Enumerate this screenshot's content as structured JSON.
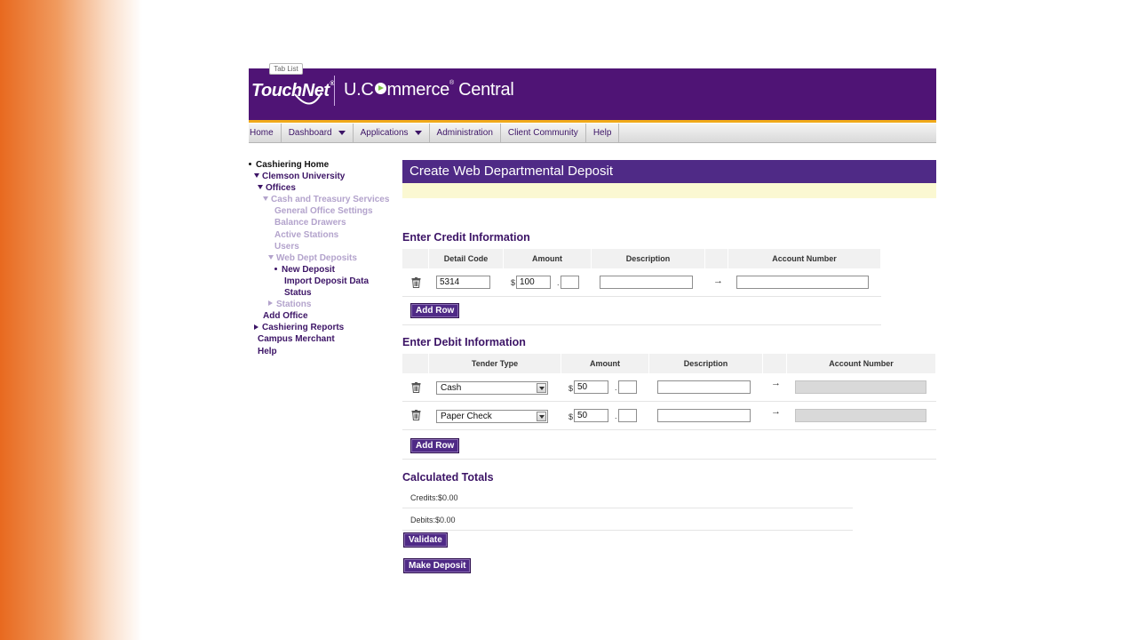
{
  "header": {
    "tab_tip": "Tab List",
    "logo_touchnet": "TouchNet",
    "logo_ucommerce_pre": "U.C",
    "logo_ucommerce_post": "mmerce",
    "logo_central": "Central",
    "colors": {
      "banner": "#4f1475",
      "accent": "#f0a91a"
    }
  },
  "nav": [
    {
      "label": "Home"
    },
    {
      "label": "Dashboard",
      "dropdown": true
    },
    {
      "label": "Applications",
      "dropdown": true
    },
    {
      "label": "Administration"
    },
    {
      "label": "Client Community"
    },
    {
      "label": "Help"
    }
  ],
  "tree": [
    {
      "label": "Cashiering Home",
      "indent": 0,
      "icon": "bullet",
      "style": "black"
    },
    {
      "label": "Clemson University",
      "indent": 1,
      "icon": "down",
      "style": "purple"
    },
    {
      "label": "Offices",
      "indent": 2,
      "icon": "down",
      "style": "purple"
    },
    {
      "label": "Cash and Treasury Services",
      "indent": 3,
      "icon": "down",
      "style": "muted"
    },
    {
      "label": "General Office Settings",
      "indent": 5,
      "icon": "",
      "style": "muted"
    },
    {
      "label": "Balance Drawers",
      "indent": 5,
      "icon": "",
      "style": "muted"
    },
    {
      "label": "Active Stations",
      "indent": 5,
      "icon": "",
      "style": "muted"
    },
    {
      "label": "Users",
      "indent": 5,
      "icon": "",
      "style": "muted"
    },
    {
      "label": "Web Dept Deposits",
      "indent": 4,
      "icon": "down",
      "style": "muted"
    },
    {
      "label": "New Deposit",
      "indent": 5,
      "icon": "bullet",
      "style": "purple"
    },
    {
      "label": "Import Deposit Data",
      "indent": 6,
      "icon": "",
      "style": "purple"
    },
    {
      "label": "Status",
      "indent": 6,
      "icon": "",
      "style": "purple"
    },
    {
      "label": "Stations",
      "indent": 4,
      "icon": "right",
      "style": "muted"
    },
    {
      "label": "Add Office",
      "indent": 3,
      "icon": "",
      "style": "purple"
    },
    {
      "label": "Cashiering Reports",
      "indent": 1,
      "icon": "right",
      "style": "purple"
    },
    {
      "label": "Campus Merchant",
      "indent": 2,
      "icon": "",
      "style": "purple"
    },
    {
      "label": "Help",
      "indent": 2,
      "icon": "",
      "style": "purple"
    }
  ],
  "main": {
    "title": "Create Web Departmental Deposit",
    "credit": {
      "heading": "Enter Credit Information",
      "columns": [
        "Detail Code",
        "Amount",
        "Description",
        "Account Number"
      ],
      "rows": [
        {
          "detail_code": "5314",
          "amount_dollars": "100",
          "amount_cents": "",
          "description": "",
          "account_number": ""
        }
      ],
      "add_row_label": "Add Row"
    },
    "debit": {
      "heading": "Enter Debit Information",
      "columns": [
        "Tender Type",
        "Amount",
        "Description",
        "Account Number"
      ],
      "rows": [
        {
          "tender_type": "Cash",
          "amount_dollars": "50",
          "amount_cents": "",
          "description": "",
          "account_number": ""
        },
        {
          "tender_type": "Paper Check",
          "amount_dollars": "50",
          "amount_cents": "",
          "description": "",
          "account_number": ""
        }
      ],
      "add_row_label": "Add Row"
    },
    "totals": {
      "heading": "Calculated Totals",
      "credits": "Credits:$0.00",
      "debits": "Debits:$0.00"
    },
    "validate_label": "Validate",
    "make_deposit_label": "Make Deposit",
    "currency_symbol": "$",
    "decimal_point": ".",
    "arrow": "→"
  }
}
